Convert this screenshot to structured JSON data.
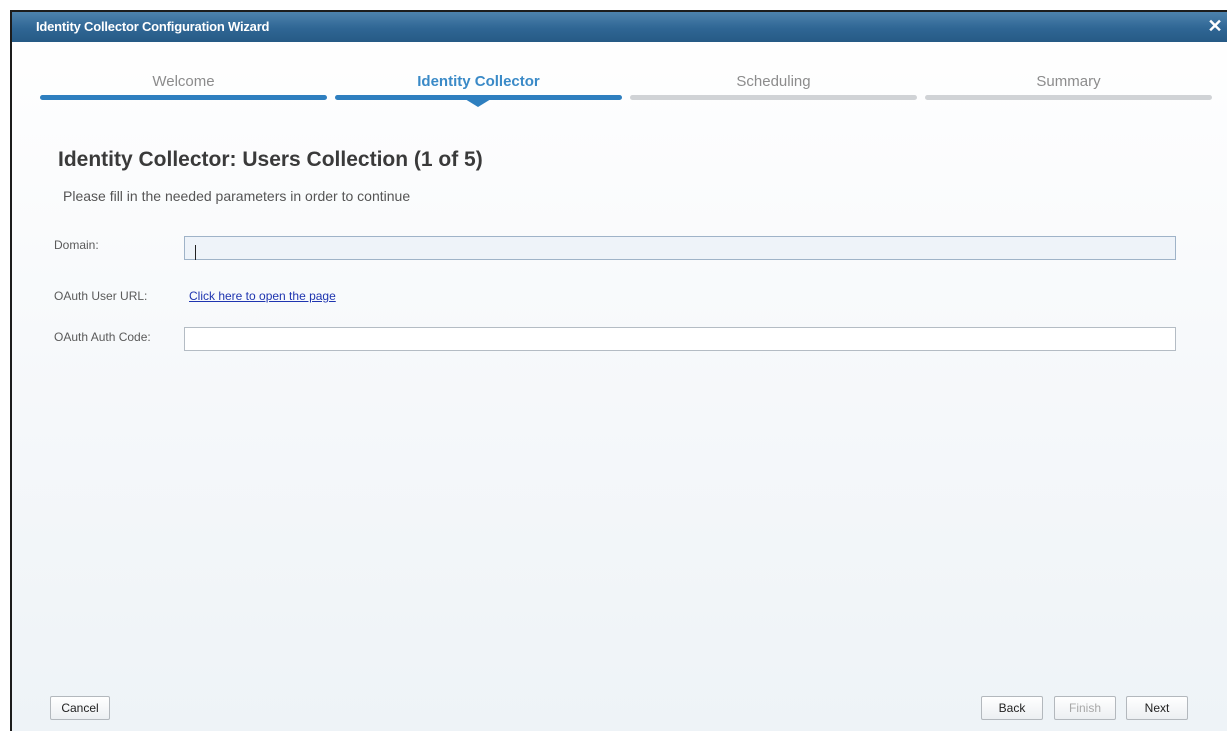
{
  "window": {
    "title": "Identity Collector Configuration Wizard",
    "close_glyph": "✕"
  },
  "steps": [
    {
      "label": "Welcome",
      "state": "done"
    },
    {
      "label": "Identity Collector",
      "state": "active"
    },
    {
      "label": "Scheduling",
      "state": "pending"
    },
    {
      "label": "Summary",
      "state": "pending"
    }
  ],
  "content": {
    "heading": "Identity Collector: Users Collection (1 of 5)",
    "subtext": "Please fill in the needed parameters in order to continue"
  },
  "form": {
    "domain_label": "Domain:",
    "domain_value": "",
    "oauth_url_label": "OAuth User URL:",
    "oauth_url_link": "Click here to open the page",
    "oauth_code_label": "OAuth Auth Code:",
    "oauth_code_value": ""
  },
  "buttons": {
    "cancel": "Cancel",
    "back": "Back",
    "finish": "Finish",
    "next": "Next"
  },
  "colors": {
    "titlebar": "#2f6694",
    "accent": "#2e7fbf",
    "link": "#1f35b0"
  }
}
